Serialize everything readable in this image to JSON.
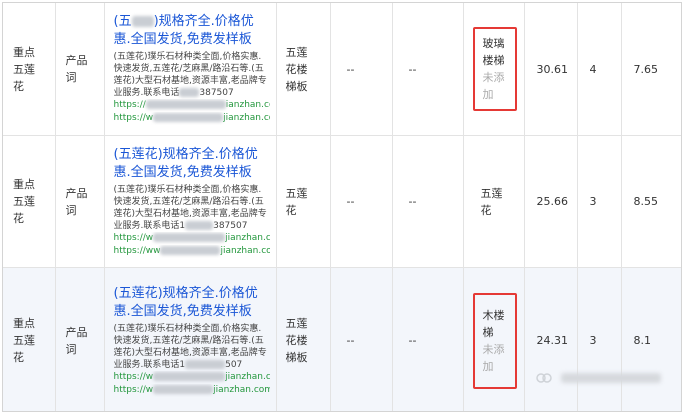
{
  "rows": [
    {
      "type": "重点五莲花",
      "kind": "产品词",
      "ad": {
        "title_prefix": "(五",
        "title_suffix": ")规格齐全.价格优惠.全国发货,免费发样板",
        "desc_pre": "(五莲花)璞乐石材种类全面,价格实惠.快速发货,五莲花/芝麻黑/路沿石等.(五莲花)大型石材基地,资源丰富,老品牌专业服务.联系电话",
        "desc_tail": "387507",
        "url1_head": "https://",
        "url1_tail": "ianzhan.com/s",
        "url2_head": "https://w",
        "url2_tail": "jianzhan.com/s"
      },
      "keyword": "五莲花楼梯板",
      "col5": "--",
      "col6": "--",
      "related_keyword": "玻璃楼梯",
      "related_status": "未添加",
      "highlighted": true,
      "value": "30.61",
      "count": "4",
      "price": "7.65"
    },
    {
      "type": "重点五莲花",
      "kind": "产品词",
      "ad": {
        "title_prefix": "(五莲花)规格齐全.价格优惠.全国发货,免费发样板",
        "title_suffix": "",
        "desc_pre": "(五莲花)璞乐石材种类全面,价格实惠.快速发货,五莲花/芝麻黑/路沿石等.(五莲花)大型石材基地,资源丰富,老品牌专业服务.联系电话1",
        "desc_tail": "387507",
        "url1_head": "https://w",
        "url1_tail": "jianzhan.com/s",
        "url2_head": "https://ww",
        "url2_tail": "jianzhan.com/s"
      },
      "keyword": "五莲花",
      "col5": "--",
      "col6": "--",
      "related_keyword": "五莲花",
      "related_status": "",
      "highlighted": false,
      "value": "25.66",
      "count": "3",
      "price": "8.55"
    },
    {
      "type": "重点五莲花",
      "kind": "产品词",
      "ad": {
        "title_prefix": "(五莲花)规格齐全.价格优惠.全国发货,免费发样板",
        "title_suffix": "",
        "desc_pre": "(五莲花)璞乐石材种类全面,价格实惠.快速发货,五莲花/芝麻黑/路沿石等.(五莲花)大型石材基地,资源丰富,老品牌专业服务.联系电话1",
        "desc_tail": "507",
        "url1_head": "https://w",
        "url1_tail": "jianzhan.com/s",
        "url2_head": "https://w",
        "url2_tail": "jianzhan.com/s"
      },
      "keyword": "五莲花楼梯板",
      "col5": "--",
      "col6": "--",
      "related_keyword": "木楼梯",
      "related_status": "未添加",
      "highlighted": true,
      "value": "24.31",
      "count": "3",
      "price": "8.1"
    }
  ],
  "colors": {
    "link": "#1a56d6",
    "url": "#23973d",
    "highlight_border": "#e53935",
    "muted": "#aaaaaa",
    "row_hover": "#f3f6fb"
  }
}
